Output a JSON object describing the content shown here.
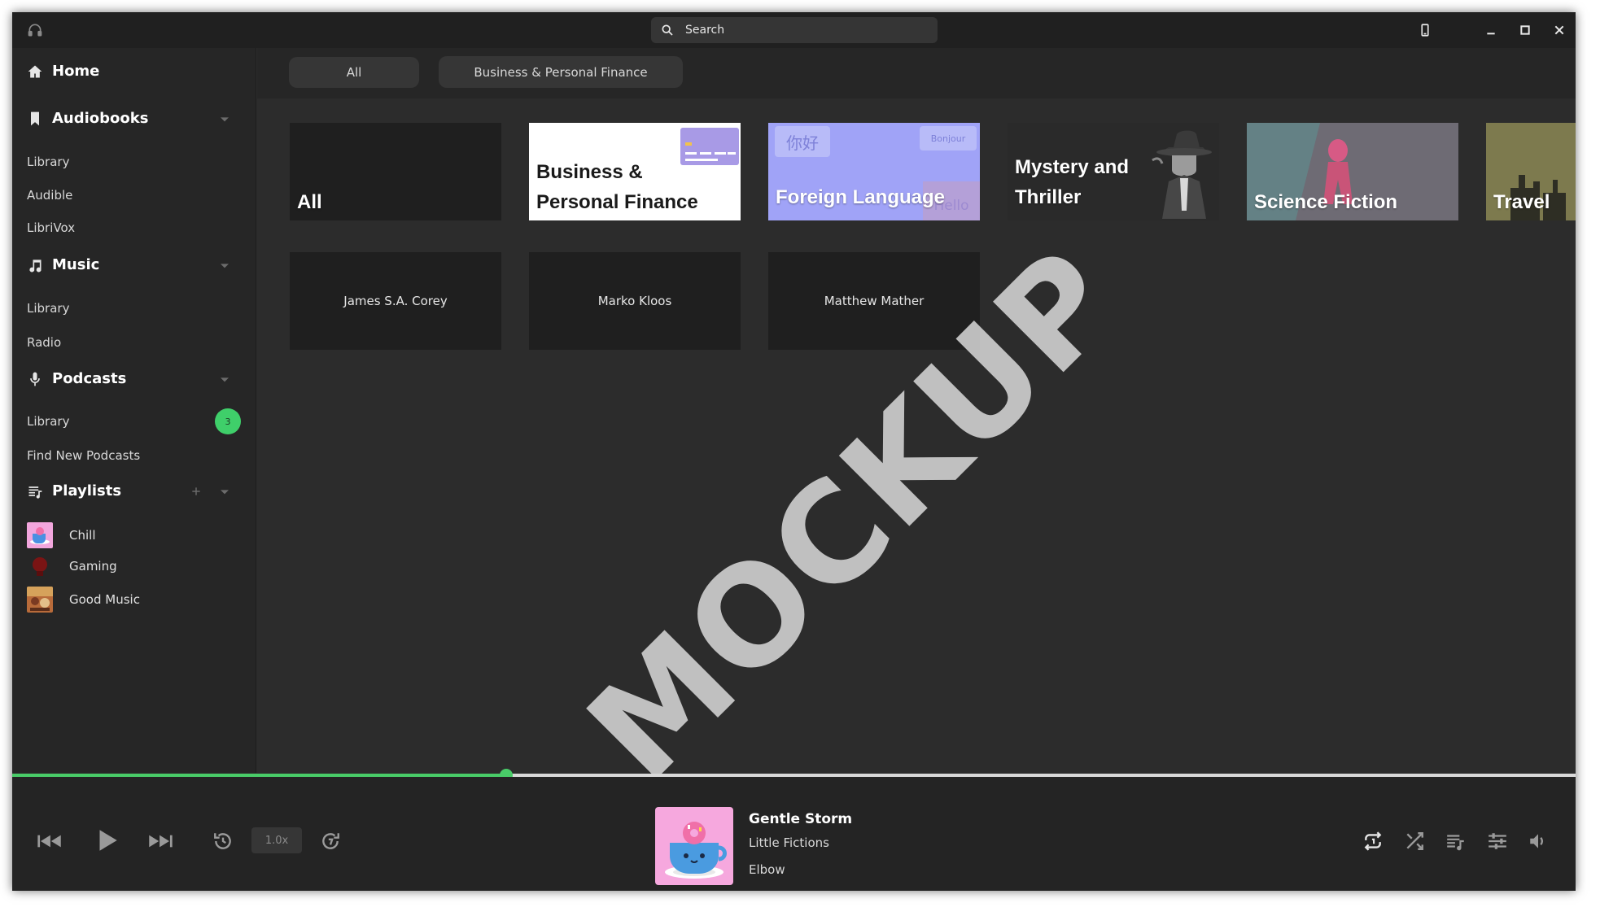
{
  "window": {
    "search_placeholder": "Search"
  },
  "sidebar": {
    "home": "Home",
    "audiobooks": {
      "title": "Audiobooks",
      "items": [
        "Library",
        "Audible",
        "LibriVox"
      ]
    },
    "music": {
      "title": "Music",
      "items": [
        "Library",
        "Radio"
      ]
    },
    "podcasts": {
      "title": "Podcasts",
      "items": [
        "Library",
        "Find New Podcasts"
      ],
      "library_badge": "3"
    },
    "playlists": {
      "title": "Playlists",
      "items": [
        "Chill",
        "Gaming",
        "Good Music"
      ]
    }
  },
  "main": {
    "chips": [
      "All",
      "Business & Personal Finance"
    ],
    "categories": [
      {
        "line1": "All",
        "line2": ""
      },
      {
        "line1": "Business &",
        "line2": "Personal Finance"
      },
      {
        "line1": "Foreign Language",
        "line2": ""
      },
      {
        "line1": "Mystery and",
        "line2": "Thriller"
      },
      {
        "line1": "Science Fiction",
        "line2": ""
      },
      {
        "line1": "Travel",
        "line2": ""
      }
    ],
    "foreign_decor": {
      "chinese": "你好",
      "bonjour": "Bonjour",
      "hello": "Hello"
    },
    "authors": [
      "James S.A. Corey",
      "Marko Kloos",
      "Matthew Mather"
    ],
    "watermark": "MOCKUP"
  },
  "player": {
    "progress": 0.316,
    "speed": "1.0x",
    "title": "Gentle Storm",
    "album": "Little Fictions",
    "artist": "Elbow",
    "accent": "#49cc68"
  }
}
